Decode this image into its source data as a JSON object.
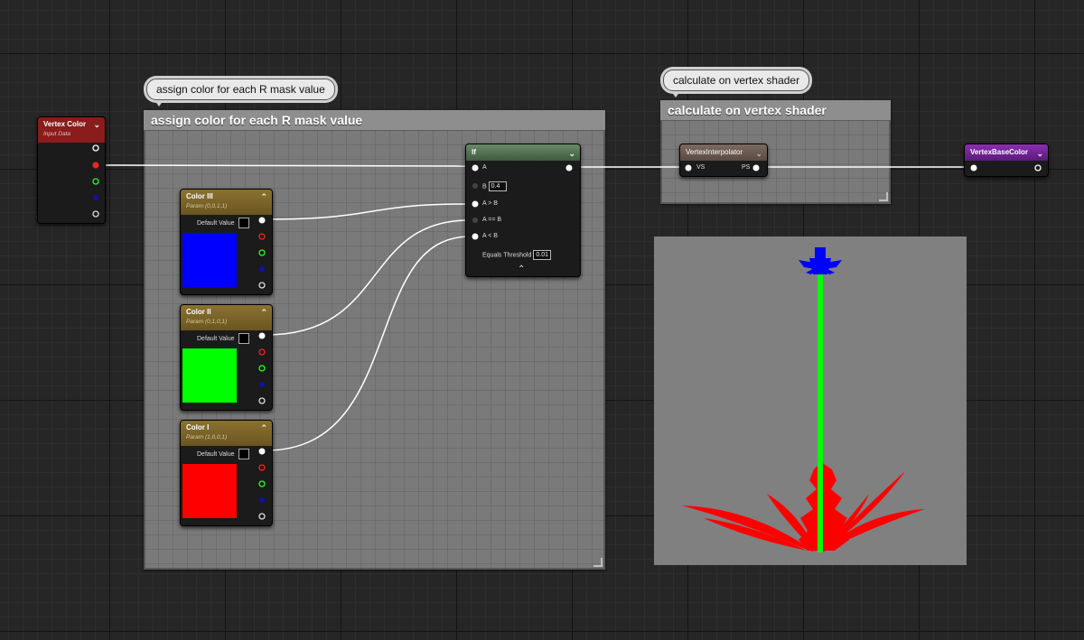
{
  "comments": {
    "assign": {
      "bubble": "assign color for each R mask value",
      "title": "assign color for each R mask value"
    },
    "vertex_shader": {
      "bubble": "calculate on vertex shader",
      "title": "calculate on vertex shader"
    }
  },
  "nodes": {
    "vertex_color": {
      "title": "Vertex Color",
      "subtitle": "Input Data",
      "header_color": "#8b1c1c"
    },
    "color3": {
      "title": "Color III",
      "subtitle": "Param (0,0,1,1)",
      "default_label": "Default Value",
      "swatch": "#0000ff",
      "header_color": "#7a6426"
    },
    "color2": {
      "title": "Color II",
      "subtitle": "Param (0,1,0,1)",
      "default_label": "Default Value",
      "swatch": "#00ff00",
      "header_color": "#7a6426"
    },
    "color1": {
      "title": "Color I",
      "subtitle": "Param (1,0,0,1)",
      "default_label": "Default Value",
      "swatch": "#ff0000",
      "header_color": "#7a6426"
    },
    "if_node": {
      "title": "If",
      "header_color": "#4f6e4f",
      "pins": {
        "a": "A",
        "b": "B",
        "b_value": "0.4",
        "a_gt_b": "A > B",
        "a_eq_b": "A == B",
        "a_lt_b": "A < B"
      },
      "threshold_label": "Equals Threshold",
      "threshold_value": "0.01"
    },
    "vertex_interpolator": {
      "title": "VertexInterpolator",
      "vs": "VS",
      "ps": "PS",
      "header_color": "#6e5a4e"
    },
    "vertex_base_color": {
      "title": "VertexBaseColor",
      "header_color": "#6a1f8c"
    }
  },
  "pin_colors": {
    "white": "#ffffff",
    "red": "#ff2020",
    "green": "#20ff20",
    "blue": "#2020ff",
    "alpha": "#dddddd"
  },
  "preview": {
    "background": "#808080"
  },
  "icons": {
    "collapse": "chevron-down-icon",
    "expand": "chevron-up-icon"
  }
}
